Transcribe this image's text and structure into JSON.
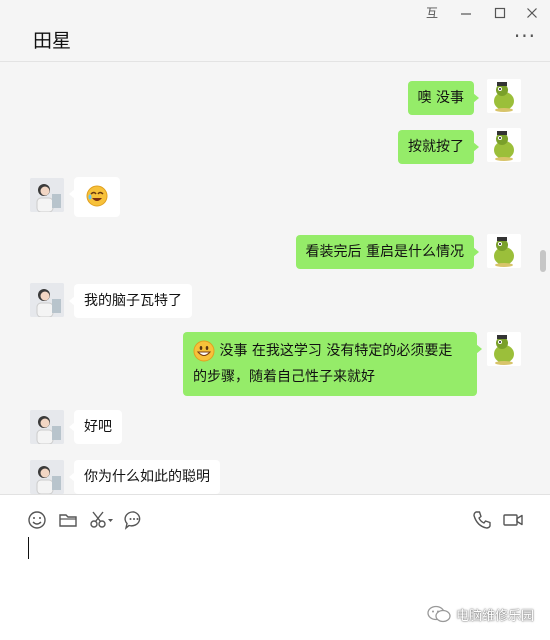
{
  "header": {
    "contact_name": "田星",
    "pin_glyph": "互",
    "more_glyph": "···"
  },
  "messages": [
    {
      "side": "right",
      "text": "噢 没事"
    },
    {
      "side": "right",
      "text": "按就按了"
    },
    {
      "side": "left",
      "emoji": "rolling-laugh-emoji"
    },
    {
      "side": "right",
      "text": "看装完后 重启是什么情况"
    },
    {
      "side": "left",
      "text": "我的脑子瓦特了"
    },
    {
      "side": "right",
      "emoji": "grin-emoji",
      "line1": "没事   在我这学习  没有特定的必须要走",
      "line2": "的步骤，随着自己性子来就好"
    },
    {
      "side": "left",
      "text": "好吧"
    },
    {
      "side": "left",
      "text": "你为什么如此的聪明"
    }
  ],
  "toolbar": {
    "icons": [
      "emoji-icon",
      "folder-icon",
      "scissors-icon",
      "chat-bubble-icon",
      "phone-icon",
      "video-icon"
    ]
  },
  "watermark": {
    "text": "电脑维修乐园"
  },
  "colors": {
    "sent_bubble": "#95ec69",
    "received_bubble": "#ffffff",
    "background": "#f5f5f5"
  }
}
